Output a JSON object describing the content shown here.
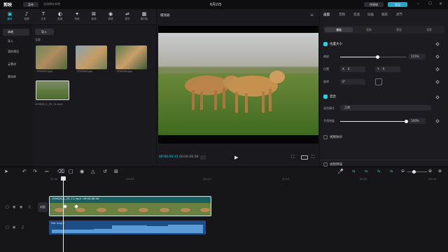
{
  "app": {
    "name": "剪映",
    "menu_label": "菜单",
    "autosave": "自动保存本地",
    "doc_title": "6月2日",
    "buttons": {
      "shortcuts": "快捷键",
      "export": "导出"
    }
  },
  "toolbar": {
    "items": [
      {
        "icon": "media-icon",
        "label": "媒体"
      },
      {
        "icon": "audio-icon",
        "label": "音频"
      },
      {
        "icon": "text-icon",
        "label": "文本"
      },
      {
        "icon": "sticker-icon",
        "label": "贴纸"
      },
      {
        "icon": "effects-icon",
        "label": "特效"
      },
      {
        "icon": "transition-icon",
        "label": "转场"
      },
      {
        "icon": "filter-icon",
        "label": "滤镜"
      },
      {
        "icon": "adjust-icon",
        "label": "调节"
      },
      {
        "icon": "template-icon",
        "label": "素材包"
      }
    ]
  },
  "leftnav": {
    "items": [
      "本地",
      "导入",
      "我的预设",
      "云素材",
      "素材库"
    ]
  },
  "media": {
    "import_label": "导入",
    "all_label": "全部",
    "items": [
      {
        "name": "1303262.jpg"
      },
      {
        "name": "1303263.jpg"
      },
      {
        "name": "1303264.jpg"
      },
      {
        "name": "190826_1_25_11.mp4"
      }
    ]
  },
  "player": {
    "title": "播放器",
    "timecode": "00:00:00:15",
    "duration": "00:00:06:06"
  },
  "inspector": {
    "tabs": [
      "画面",
      "音频",
      "变速",
      "动画",
      "跟踪",
      "调节"
    ],
    "subtabs": [
      "基础",
      "抠像",
      "蒙版",
      "背景"
    ],
    "position_size": {
      "title": "位置大小",
      "scale_label": "缩放",
      "scale_value": "115%",
      "scale_fraction": 0.56,
      "position_label": "位置",
      "x_label": "X",
      "x_value": "0",
      "y_label": "Y",
      "y_value": "0",
      "rotate_label": "旋转",
      "rotate_value": "0°"
    },
    "blend": {
      "title": "混合",
      "mode_label": "混合模式",
      "mode_value": "正常",
      "opacity_label": "不透明度",
      "opacity_value": "100%",
      "opacity_fraction": 1.0
    },
    "stabilize": {
      "title": "视频防抖"
    },
    "denoise": {
      "title": "视频降噪"
    }
  },
  "timeline": {
    "ruler_ticks": [
      "00:00",
      "|00:05",
      "|00:10",
      "00:15",
      "00:20",
      "|00:12"
    ],
    "video_clip": {
      "name": "190826_1_25_11.mp4",
      "duration": "00:00:06:06"
    },
    "cover_label": "封面",
    "audio_clip": {
      "name": "Not Angry"
    }
  },
  "colors": {
    "accent": "#22d3e8",
    "clip": "#1f6f72",
    "audio": "#1d4f86",
    "export": "#27a6c9"
  }
}
